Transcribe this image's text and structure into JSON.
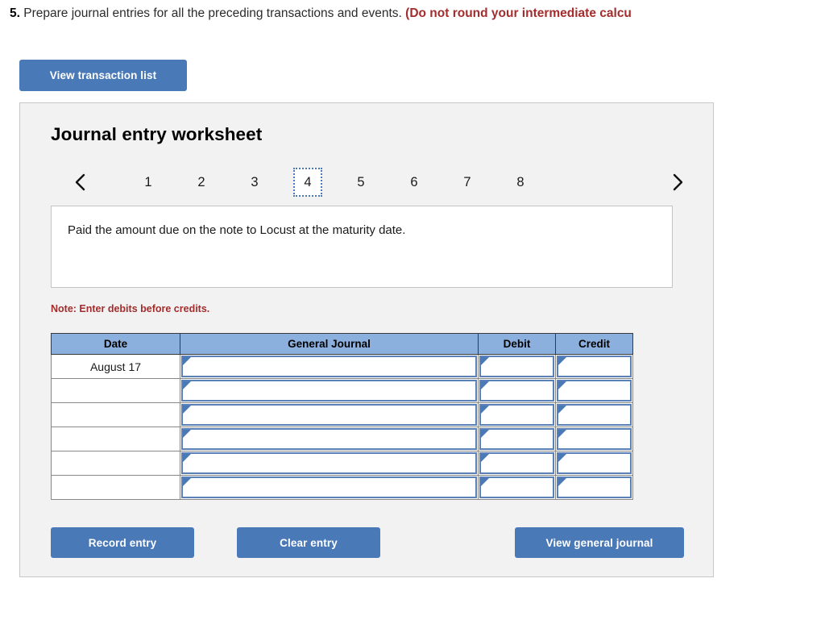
{
  "question": {
    "number": "5.",
    "text": "Prepare journal entries for all the preceding transactions and events.",
    "warning": "(Do not round your intermediate calcu"
  },
  "toolbar": {
    "view_transaction_list": "View transaction list"
  },
  "worksheet": {
    "title": "Journal entry worksheet",
    "prev_icon": "chevron-left-icon",
    "next_icon": "chevron-right-icon",
    "tabs": [
      {
        "label": "1",
        "selected": false
      },
      {
        "label": "2",
        "selected": false
      },
      {
        "label": "3",
        "selected": false
      },
      {
        "label": "4",
        "selected": true
      },
      {
        "label": "5",
        "selected": false
      },
      {
        "label": "6",
        "selected": false
      },
      {
        "label": "7",
        "selected": false
      },
      {
        "label": "8",
        "selected": false
      }
    ],
    "description": "Paid the amount due on the note to Locust at the maturity date.",
    "note": "Note: Enter debits before credits.",
    "table": {
      "headers": [
        "Date",
        "General Journal",
        "Debit",
        "Credit"
      ],
      "rows": [
        {
          "date": "August 17",
          "general_journal": "",
          "debit": "",
          "credit": ""
        },
        {
          "date": "",
          "general_journal": "",
          "debit": "",
          "credit": ""
        },
        {
          "date": "",
          "general_journal": "",
          "debit": "",
          "credit": ""
        },
        {
          "date": "",
          "general_journal": "",
          "debit": "",
          "credit": ""
        },
        {
          "date": "",
          "general_journal": "",
          "debit": "",
          "credit": ""
        },
        {
          "date": "",
          "general_journal": "",
          "debit": "",
          "credit": ""
        }
      ]
    },
    "buttons": {
      "record_entry": "Record entry",
      "clear_entry": "Clear entry",
      "view_general_journal": "View general journal"
    }
  },
  "colors": {
    "button_blue": "#4a79b8",
    "table_header_blue": "#8cb0de",
    "warning_red": "#a32c2c",
    "panel_background": "#f2f2f2",
    "input_border_blue": "#5a82b8"
  }
}
